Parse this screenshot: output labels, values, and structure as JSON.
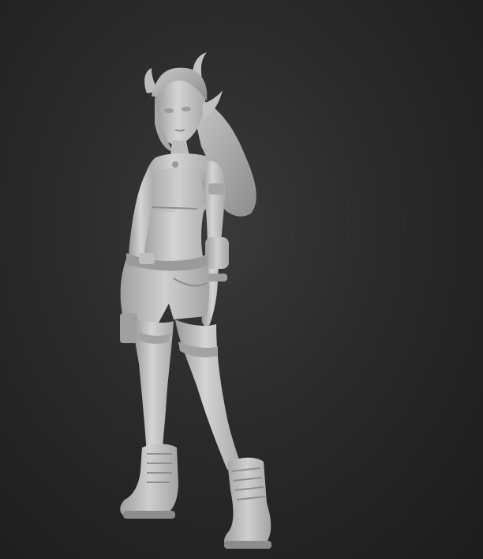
{
  "scene": {
    "subject": "sculpt-figure",
    "colors": {
      "background_center": "#3a3a3a",
      "background_edge": "#1c1c1c",
      "clay_light": "#d2d2d2",
      "clay_mid": "#b4b4b4",
      "clay_dark": "#8a8a8a",
      "clay_shadow": "#6e6e6e"
    }
  }
}
